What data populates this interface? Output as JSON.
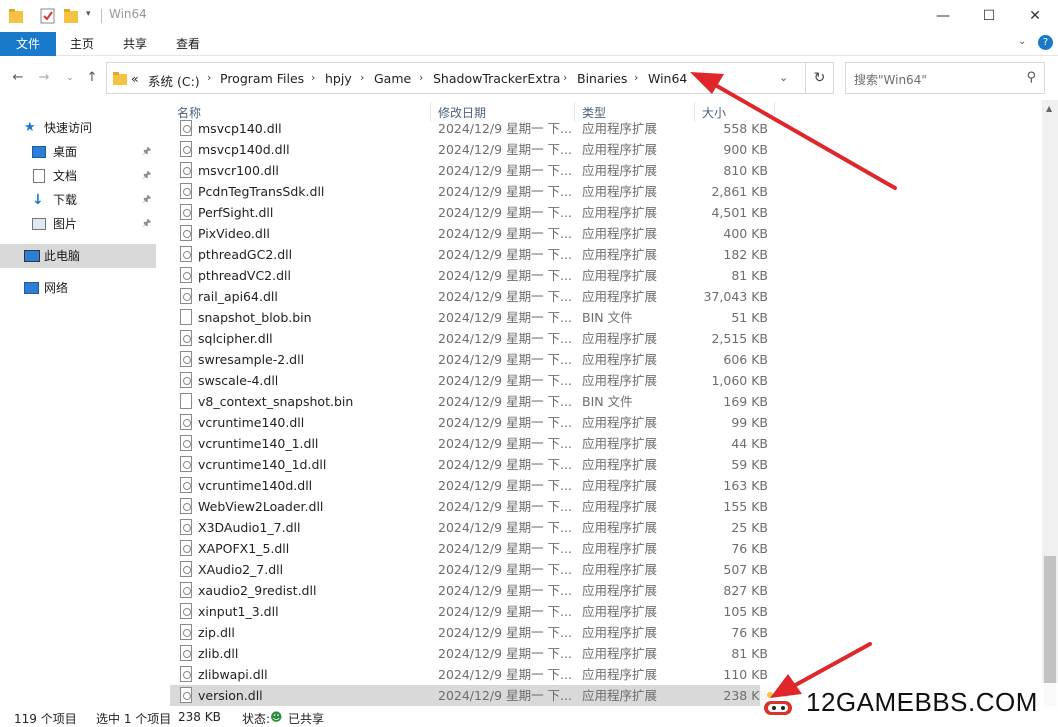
{
  "window": {
    "title": "Win64"
  },
  "ribbon": {
    "tabs": [
      "文件",
      "主页",
      "共享",
      "查看"
    ]
  },
  "breadcrumb": {
    "overflow": "«",
    "items": [
      "系统 (C:)",
      "Program Files",
      "hpjy",
      "Game",
      "ShadowTrackerExtra",
      "Binaries",
      "Win64"
    ]
  },
  "search": {
    "placeholder": "搜索\"Win64\""
  },
  "nav": {
    "quick_access": "快速访问",
    "desktop": "桌面",
    "documents": "文档",
    "downloads": "下载",
    "pictures": "图片",
    "this_pc": "此电脑",
    "network": "网络"
  },
  "columns": {
    "name": "名称",
    "date": "修改日期",
    "type": "类型",
    "size": "大小"
  },
  "files": [
    {
      "name": "msvcp140.dll",
      "date": "2024/12/9 星期一 下...",
      "type": "应用程序扩展",
      "size": "558 KB",
      "kind": "dll"
    },
    {
      "name": "msvcp140d.dll",
      "date": "2024/12/9 星期一 下...",
      "type": "应用程序扩展",
      "size": "900 KB",
      "kind": "dll"
    },
    {
      "name": "msvcr100.dll",
      "date": "2024/12/9 星期一 下...",
      "type": "应用程序扩展",
      "size": "810 KB",
      "kind": "dll"
    },
    {
      "name": "PcdnTegTransSdk.dll",
      "date": "2024/12/9 星期一 下...",
      "type": "应用程序扩展",
      "size": "2,861 KB",
      "kind": "dll"
    },
    {
      "name": "PerfSight.dll",
      "date": "2024/12/9 星期一 下...",
      "type": "应用程序扩展",
      "size": "4,501 KB",
      "kind": "dll"
    },
    {
      "name": "PixVideo.dll",
      "date": "2024/12/9 星期一 下...",
      "type": "应用程序扩展",
      "size": "400 KB",
      "kind": "dll"
    },
    {
      "name": "pthreadGC2.dll",
      "date": "2024/12/9 星期一 下...",
      "type": "应用程序扩展",
      "size": "182 KB",
      "kind": "dll"
    },
    {
      "name": "pthreadVC2.dll",
      "date": "2024/12/9 星期一 下...",
      "type": "应用程序扩展",
      "size": "81 KB",
      "kind": "dll"
    },
    {
      "name": "rail_api64.dll",
      "date": "2024/12/9 星期一 下...",
      "type": "应用程序扩展",
      "size": "37,043 KB",
      "kind": "dll"
    },
    {
      "name": "snapshot_blob.bin",
      "date": "2024/12/9 星期一 下...",
      "type": "BIN 文件",
      "size": "51 KB",
      "kind": "bin"
    },
    {
      "name": "sqlcipher.dll",
      "date": "2024/12/9 星期一 下...",
      "type": "应用程序扩展",
      "size": "2,515 KB",
      "kind": "dll"
    },
    {
      "name": "swresample-2.dll",
      "date": "2024/12/9 星期一 下...",
      "type": "应用程序扩展",
      "size": "606 KB",
      "kind": "dll"
    },
    {
      "name": "swscale-4.dll",
      "date": "2024/12/9 星期一 下...",
      "type": "应用程序扩展",
      "size": "1,060 KB",
      "kind": "dll"
    },
    {
      "name": "v8_context_snapshot.bin",
      "date": "2024/12/9 星期一 下...",
      "type": "BIN 文件",
      "size": "169 KB",
      "kind": "bin"
    },
    {
      "name": "vcruntime140.dll",
      "date": "2024/12/9 星期一 下...",
      "type": "应用程序扩展",
      "size": "99 KB",
      "kind": "dll"
    },
    {
      "name": "vcruntime140_1.dll",
      "date": "2024/12/9 星期一 下...",
      "type": "应用程序扩展",
      "size": "44 KB",
      "kind": "dll"
    },
    {
      "name": "vcruntime140_1d.dll",
      "date": "2024/12/9 星期一 下...",
      "type": "应用程序扩展",
      "size": "59 KB",
      "kind": "dll"
    },
    {
      "name": "vcruntime140d.dll",
      "date": "2024/12/9 星期一 下...",
      "type": "应用程序扩展",
      "size": "163 KB",
      "kind": "dll"
    },
    {
      "name": "WebView2Loader.dll",
      "date": "2024/12/9 星期一 下...",
      "type": "应用程序扩展",
      "size": "155 KB",
      "kind": "dll"
    },
    {
      "name": "X3DAudio1_7.dll",
      "date": "2024/12/9 星期一 下...",
      "type": "应用程序扩展",
      "size": "25 KB",
      "kind": "dll"
    },
    {
      "name": "XAPOFX1_5.dll",
      "date": "2024/12/9 星期一 下...",
      "type": "应用程序扩展",
      "size": "76 KB",
      "kind": "dll"
    },
    {
      "name": "XAudio2_7.dll",
      "date": "2024/12/9 星期一 下...",
      "type": "应用程序扩展",
      "size": "507 KB",
      "kind": "dll"
    },
    {
      "name": "xaudio2_9redist.dll",
      "date": "2024/12/9 星期一 下...",
      "type": "应用程序扩展",
      "size": "827 KB",
      "kind": "dll"
    },
    {
      "name": "xinput1_3.dll",
      "date": "2024/12/9 星期一 下...",
      "type": "应用程序扩展",
      "size": "105 KB",
      "kind": "dll"
    },
    {
      "name": "zip.dll",
      "date": "2024/12/9 星期一 下...",
      "type": "应用程序扩展",
      "size": "76 KB",
      "kind": "dll"
    },
    {
      "name": "zlib.dll",
      "date": "2024/12/9 星期一 下...",
      "type": "应用程序扩展",
      "size": "81 KB",
      "kind": "dll"
    },
    {
      "name": "zlibwapi.dll",
      "date": "2024/12/9 星期一 下...",
      "type": "应用程序扩展",
      "size": "110 KB",
      "kind": "dll"
    },
    {
      "name": "version.dll",
      "date": "2024/12/9 星期一 下...",
      "type": "应用程序扩展",
      "size": "238 KB",
      "kind": "dll",
      "selected": true
    }
  ],
  "status": {
    "count": "119 个项目",
    "selected": "选中 1 个项目",
    "selected_size": "238 KB",
    "state_label": "状态:",
    "state_value": "已共享"
  },
  "watermark": {
    "text": "12GAMEBBS.COM"
  },
  "colors": {
    "accent": "#1979ca",
    "arrow": "#e0262b",
    "selection": "#d9d9d9"
  }
}
